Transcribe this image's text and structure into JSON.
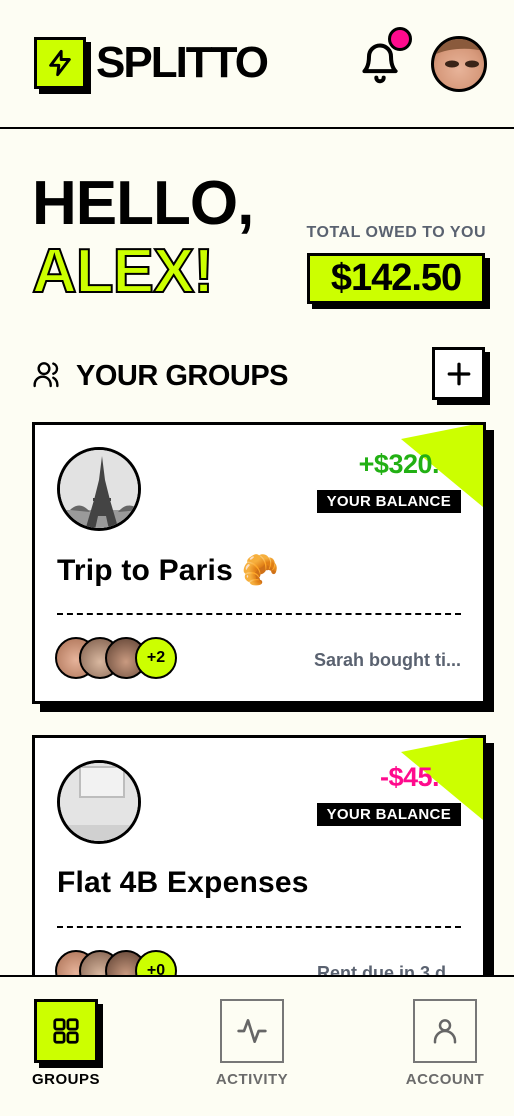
{
  "app": {
    "name": "SPLITTO"
  },
  "greeting": {
    "line1": "HELLO,",
    "name": "ALEX!"
  },
  "summary": {
    "label": "TOTAL OWED TO YOU",
    "amount": "$142.50"
  },
  "groups_section": {
    "title": "YOUR GROUPS"
  },
  "groups": [
    {
      "name": "Trip to Paris 🥐",
      "balance": "+$320.",
      "balance_label": "YOUR BALANCE",
      "more_members": "+2",
      "latest_activity": "Sarah bought ti..."
    },
    {
      "name": "Flat 4B Expenses",
      "balance": "-$45.",
      "balance_label": "YOUR BALANCE",
      "more_members": "+0",
      "latest_activity": "Rent due in 3 d..."
    }
  ],
  "nav": [
    {
      "label": "GROUPS",
      "icon": "grid-icon",
      "active": true
    },
    {
      "label": "ACTIVITY",
      "icon": "pulse-icon",
      "active": false
    },
    {
      "label": "ACCOUNT",
      "icon": "user-icon",
      "active": false
    }
  ],
  "colors": {
    "accent": "#ccff00",
    "positive": "#22b014",
    "negative": "#ff0a8d",
    "notification": "#ff0a8d"
  }
}
